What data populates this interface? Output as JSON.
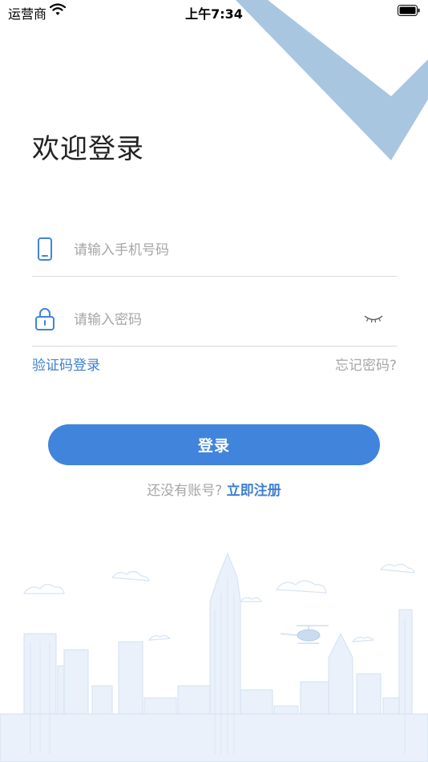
{
  "status_bar": {
    "carrier": "运营商",
    "time": "上午7:34"
  },
  "title": "欢迎登录",
  "phone_field": {
    "placeholder": "请输入手机号码",
    "icon": "phone-icon"
  },
  "password_field": {
    "placeholder": "请输入密码",
    "icon": "lock-icon",
    "toggle_icon": "eye-closed-icon"
  },
  "links": {
    "sms_login": "验证码登录",
    "forgot_password": "忘记密码?"
  },
  "login_button": "登录",
  "register": {
    "question": "还没有账号?",
    "link": "立即注册"
  },
  "colors": {
    "accent": "#4184dc",
    "link": "#3f7fcf",
    "placeholder": "#a6a6a6",
    "divider": "#dcdcdc",
    "corner_deco": "#a9c6e0"
  }
}
